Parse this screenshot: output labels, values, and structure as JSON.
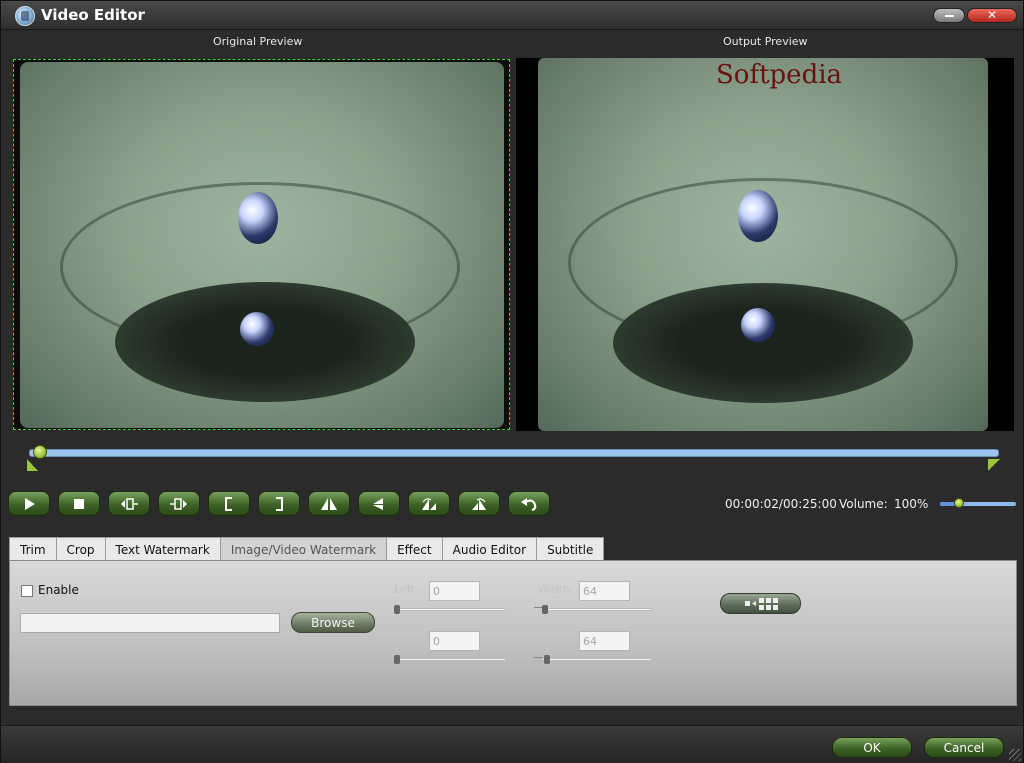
{
  "window": {
    "title": "Video Editor"
  },
  "window_controls": {
    "close_glyph": "✕"
  },
  "preview": {
    "original_label": "Original Preview",
    "output_label": "Output Preview",
    "watermark_text": "Softpedia"
  },
  "playback": {
    "position_fraction": 0.01,
    "time": "00:00:02/00:25:00",
    "volume_label": "Volume:",
    "volume_value": "100%",
    "volume_fraction": 0.25
  },
  "controls": [
    {
      "name": "play-button",
      "icon": "play-icon"
    },
    {
      "name": "stop-button",
      "icon": "stop-icon"
    },
    {
      "name": "prev-frame-button",
      "icon": "prev-frame-icon"
    },
    {
      "name": "next-frame-button",
      "icon": "next-frame-icon"
    },
    {
      "name": "mark-in-button",
      "icon": "bracket-open-icon"
    },
    {
      "name": "mark-out-button",
      "icon": "bracket-close-icon"
    },
    {
      "name": "flip-horizontal-button",
      "icon": "flip-horizontal-icon"
    },
    {
      "name": "flip-vertical-button",
      "icon": "flip-vertical-icon"
    },
    {
      "name": "rotate-left-button",
      "icon": "rotate-left-icon"
    },
    {
      "name": "rotate-right-button",
      "icon": "rotate-right-icon"
    },
    {
      "name": "reset-button",
      "icon": "undo-icon"
    }
  ],
  "tabs": [
    "Trim",
    "Crop",
    "Text Watermark",
    "Image/Video Watermark",
    "Effect",
    "Audio Editor",
    "Subtitle"
  ],
  "active_tab": "Image/Video Watermark",
  "watermark_panel": {
    "enable_label": "Enable",
    "enabled": false,
    "file_path": "",
    "browse_label": "Browse",
    "left_label": "Left:",
    "left_value": "0",
    "top_value": "0",
    "width_label": "Width:",
    "width_value": "64",
    "height_value": "64"
  },
  "footer": {
    "ok_label": "OK",
    "cancel_label": "Cancel"
  }
}
